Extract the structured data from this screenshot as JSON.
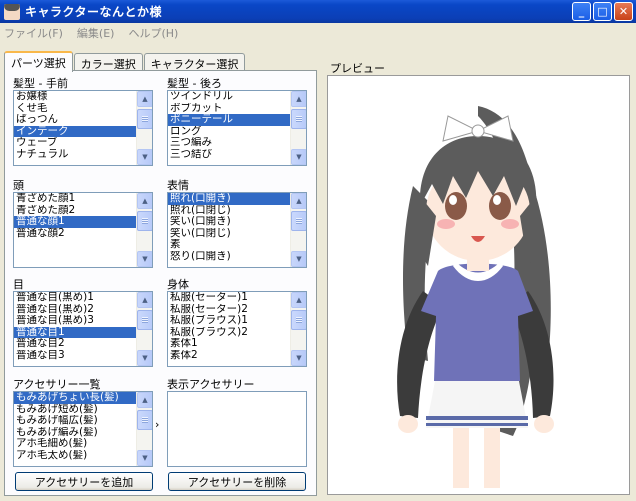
{
  "window": {
    "title": "キャラクターなんとか様"
  },
  "window_buttons": {
    "minimize": "_",
    "maximize": "□",
    "close": "✕"
  },
  "menu": [
    "ファイル(F)",
    "編集(E)",
    "ヘルプ(H)"
  ],
  "tabs": [
    "パーツ選択",
    "カラー選択",
    "キャラクター選択"
  ],
  "sections": {
    "front_hair": {
      "label": "髪型 - 手前",
      "items": [
        "お嬢様",
        "くせ毛",
        "ぱっつん",
        "インテーク",
        "ウェーブ",
        "ナチュラル"
      ],
      "selected": 3
    },
    "back_hair": {
      "label": "髪型 - 後ろ",
      "items": [
        "ツインドリル",
        "ボブカット",
        "ポニーテール",
        "ロング",
        "三つ編み",
        "三つ結び"
      ],
      "selected": 2
    },
    "head": {
      "label": "頭",
      "items": [
        "青ざめた顔1",
        "青ざめた顔2",
        "普通な顔1",
        "普通な顔2"
      ],
      "selected": 2
    },
    "expression": {
      "label": "表情",
      "items": [
        "照れ(口開き)",
        "照れ(口閉じ)",
        "笑い(口開き)",
        "笑い(口閉じ)",
        "素",
        "怒り(口開き)"
      ],
      "selected": 0
    },
    "eyes": {
      "label": "目",
      "items": [
        "普通な目(黒め)1",
        "普通な目(黒め)2",
        "普通な目(黒め)3",
        "普通な目1",
        "普通な目2",
        "普通な目3"
      ],
      "selected": 3
    },
    "body": {
      "label": "身体",
      "items": [
        "私服(セーター)1",
        "私服(セーター)2",
        "私服(ブラウス)1",
        "私服(ブラウス)2",
        "素体1",
        "素体2"
      ],
      "selected": -1
    },
    "accessory_list": {
      "label": "アクセサリー一覧",
      "items": [
        "もみあげちょい長(髪)",
        "もみあげ短め(髪)",
        "もみあげ幅広(髪)",
        "もみあげ編み(髪)",
        "アホ毛細め(髪)",
        "アホ毛太め(髪)"
      ],
      "selected": 0
    },
    "displayed_accessories": {
      "label": "表示アクセサリー",
      "items": []
    }
  },
  "arrow": "›",
  "buttons": {
    "add_accessory": "アクセサリーを追加",
    "remove_accessory": "アクセサリーを削除"
  },
  "preview": {
    "label": "プレビュー",
    "colors": {
      "hair": "#5c5c5c",
      "hair_shadow": "#3a3a3a",
      "skin": "#fde9dc",
      "eyes": "#8a5a48",
      "shirt": "#6f72b8",
      "sleeve": "#3b3b3b",
      "skirt": "#f5f5f5",
      "skirt_stripe": "#5a6aa8",
      "ribbon": "#ffffff"
    }
  }
}
